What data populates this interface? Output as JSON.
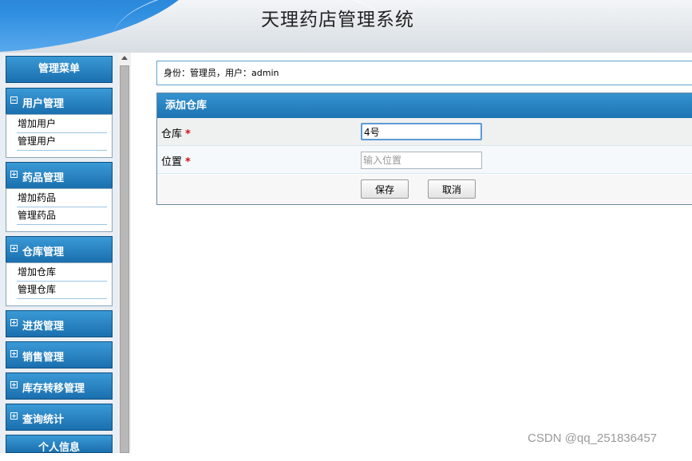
{
  "app": {
    "title": "天理药店管理系统"
  },
  "sidebar": {
    "menu_title": "管理菜单",
    "groups": [
      {
        "label": "用户管理",
        "toggle": "minus",
        "items": [
          "增加用户",
          "管理用户"
        ]
      },
      {
        "label": "药品管理",
        "toggle": "plus",
        "items": [
          "增加药品",
          "管理药品"
        ]
      },
      {
        "label": "仓库管理",
        "toggle": "plus",
        "items": [
          "增加仓库",
          "管理仓库"
        ]
      },
      {
        "label": "进货管理",
        "toggle": "plus",
        "items": []
      },
      {
        "label": "销售管理",
        "toggle": "plus",
        "items": []
      },
      {
        "label": "库存转移管理",
        "toggle": "plus",
        "items": []
      },
      {
        "label": "查询统计",
        "toggle": "plus",
        "items": []
      }
    ],
    "personal_info": "个人信息"
  },
  "identity": {
    "text": "身份：管理员，用户：admin"
  },
  "form": {
    "title": "添加仓库",
    "fields": [
      {
        "label": "仓库",
        "required_mark": "*",
        "value": "4号",
        "placeholder": ""
      },
      {
        "label": "位置",
        "required_mark": "*",
        "value": "",
        "placeholder": "输入位置"
      }
    ],
    "save_label": "保存",
    "cancel_label": "取消"
  },
  "watermark": "CSDN @qq_251836457",
  "colors": {
    "header_blue": "#1a6fc4",
    "menu_blue": "#1b6fae",
    "required_red": "#d01010"
  }
}
